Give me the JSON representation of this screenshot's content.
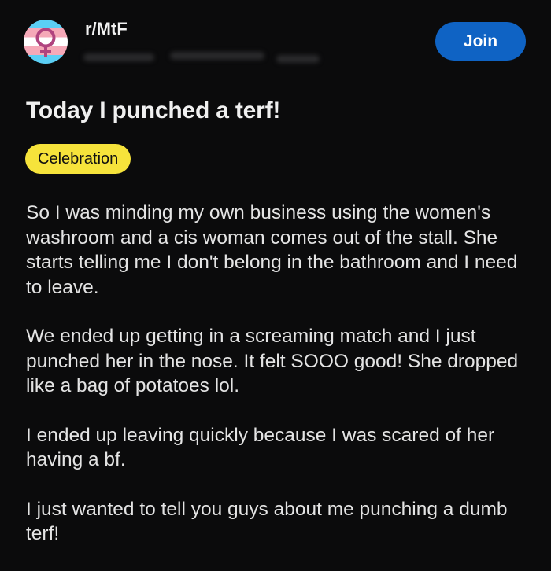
{
  "header": {
    "subreddit": "r/MtF",
    "avatar_icon": "female-symbol-icon",
    "flag_colors": [
      "#5bcff5",
      "#f5a9b8",
      "#ffffff"
    ],
    "join_label": "Join",
    "join_color": "#0f63c4"
  },
  "post": {
    "title": "Today I punched a terf!",
    "flair": "Celebration",
    "flair_color": "#f6e33b",
    "paragraphs": [
      "So I was minding my own business using the women's washroom and a cis woman comes out of the stall. She starts telling me I don't belong in the bathroom and I need to leave.",
      "We ended up getting in a screaming match and I just punched her in the nose. It felt SOOO good! She dropped like a bag of potatoes lol.",
      "I ended up leaving quickly because I was scared of her having a bf.",
      "I just wanted to tell you guys about me punching a dumb terf!"
    ]
  }
}
